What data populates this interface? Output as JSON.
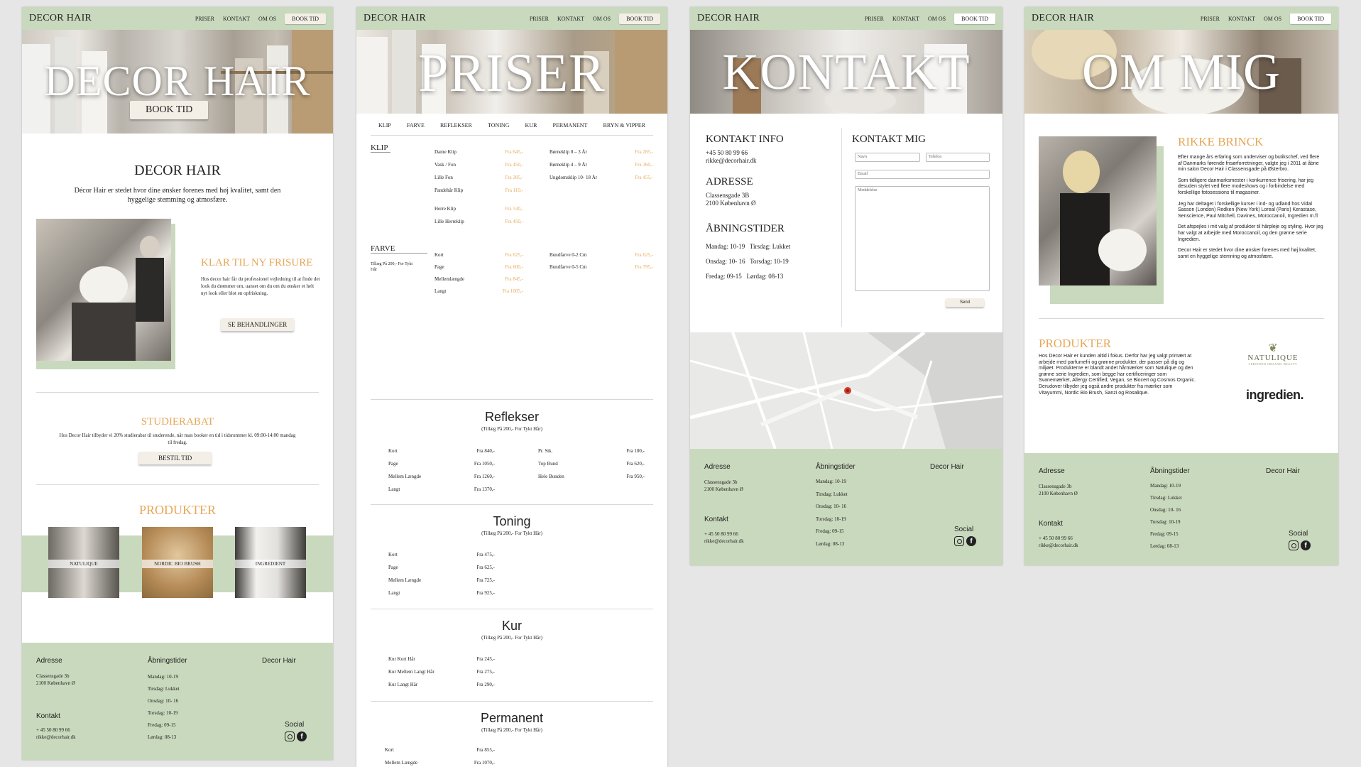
{
  "nav": {
    "logo": "DECOR HAIR",
    "links": [
      "PRISER",
      "KONTAKT",
      "OM OS"
    ],
    "book": "BOOK TID"
  },
  "p1": {
    "hero_title": "DECOR HAIR",
    "hero_button": "BOOK TID",
    "intro_title": "DECOR HAIR",
    "intro_text": "Décor Hair er stedet hvor dine ønsker forenes med høj kvalitet, samt den hyggelige stemming og atmosfære.",
    "klar_title": "KLAR TIL NY FRISURE",
    "klar_text": "Hos decor hair får du professionel vejledning til at finde det look du drømmer om, uanset om du om du ønsker et helt nyt look eller blot en opfriskning.",
    "klar_button": "SE BEHANDLINGER",
    "studie_title": "STUDIERABAT",
    "studie_text": "Hos Decor Hair tilbyder vi 20% studierabat til studerende, når man booker en tid i tidsrummet kl. 09:00-14:00 mandag til fredag.",
    "studie_button": "BESTIL TID",
    "produkter_title": "PRODUKTER",
    "products": [
      "NATULIQUE",
      "NORDIC BIO BRUSH",
      "INGREDIENT"
    ]
  },
  "footer": {
    "adresse_label": "Adresse",
    "adresse": [
      "Classensgade 3b",
      "2100 København Ø"
    ],
    "kontakt_label": "Kontakt",
    "kontakt": [
      "+ 45 50 80 99 66",
      "rikke@decorhair.dk"
    ],
    "aabning_label": "Åbningstider",
    "aabning": [
      "Mandag: 10-19",
      "Tirsdag: Lukket",
      "Onsdag: 10- 16",
      "Torsdag: 10-19",
      "Fredag: 09-15",
      "Lørdag: 08-13"
    ],
    "brand": "Decor Hair",
    "social": "Social"
  },
  "p2": {
    "hero_title": "PRISER",
    "tabs": [
      "KLIP",
      "FARVE",
      "REFLEKSER",
      "TONING",
      "KUR",
      "PERMANENT",
      "BRYN & VIPPER"
    ],
    "klip_label": "KLIP",
    "klip_left": [
      [
        "Dame Klip",
        "Fra 645,-"
      ],
      [
        "Vask / Fon",
        "Fra 450,-"
      ],
      [
        "Lille Fon",
        "Fra 285,-"
      ],
      [
        "Pandehår Klip",
        "Fra 110,-"
      ],
      [
        "",
        ""
      ],
      [
        "Herre Klip",
        "Fra 530,-"
      ],
      [
        "Lille Herreklip",
        "Fra 450,-"
      ]
    ],
    "klip_right": [
      [
        "Børneklip 0 – 3 År",
        "Fra 285,-"
      ],
      [
        "Børneklip 4 – 9 År",
        "Fra 360,-"
      ],
      [
        "Ungdomsklip 10- 18 År",
        "Fra 455,-"
      ]
    ],
    "farve_label": "FARVE",
    "farve_note": "Tillæg På 200,- For Tykt Hår",
    "farve_left": [
      [
        "Kort",
        "Fra 625,-"
      ],
      [
        "Page",
        "Fra 600,-"
      ],
      [
        "Mellemlængde",
        "Fra 845,-"
      ],
      [
        "Langt",
        "Fra 1005,-"
      ]
    ],
    "farve_right": [
      [
        "Bundfarve 0-2 Cm",
        "Fra 625,-"
      ],
      [
        "Bundfarve 0-5 Cm",
        "Fra 795,-"
      ]
    ],
    "ref_title": "Reflekser",
    "ref_note": "(Tillæg På 200,- For Tykt Hår)",
    "ref_left": [
      [
        "Kort",
        "Fra 840,-"
      ],
      [
        "Page",
        "Fra 1050,-"
      ],
      [
        "Mellem Længde",
        "Fra 1260,-"
      ],
      [
        "Langt",
        "Fra 1370,-"
      ]
    ],
    "ref_right": [
      [
        "Pr. Stk.",
        "Fra 100,-"
      ],
      [
        "Top Bund",
        "Fra 620,-"
      ],
      [
        "Hele Bunden",
        "Fra 950,-"
      ]
    ],
    "ton_title": "Toning",
    "ton_note": "(Tillæg På 200,- For Tykt Hår)",
    "ton_rows": [
      [
        "Kort",
        "Fra 475,-"
      ],
      [
        "Page",
        "Fra 625,-"
      ],
      [
        "Mellem Længde",
        "Fra 725,-"
      ],
      [
        "Langt",
        "Fra 925,-"
      ]
    ],
    "kur_title": "Kur",
    "kur_note": "(Tillæg På 200,- For Tykt Hår)",
    "kur_rows": [
      [
        "Kur Kort Hår",
        "Fra 245,-"
      ],
      [
        "Kur Mellem Langt Hår",
        "Fra 275,-"
      ],
      [
        "Kur Langt Hår",
        "Fra 290,-"
      ]
    ],
    "perm_title": "Permanent",
    "perm_note": "(Tillæg På 200,- For Tykt Hår)",
    "perm_rows": [
      [
        "Kort",
        "Fra 855,-"
      ],
      [
        "Mellem Længde",
        "Fra 1070,-"
      ]
    ]
  },
  "p3": {
    "hero_title": "KONTAKT",
    "info_title": "KONTAKT INFO",
    "info_phone": "+45 50 80 99 66",
    "info_email": "rikke@decorhair.dk",
    "adresse_title": "ADRESSE",
    "adresse_lines": [
      "Classensgade 3B",
      "2100 København Ø"
    ],
    "aabning_title": "ÅBNINGSTIDER",
    "aabning_lines": [
      "Mandag: 10-19   Tirsdag: Lukket",
      "Onsdag: 10- 16   Torsdag: 10-19",
      "Fredag: 09-15   Lørdag: 08-13"
    ],
    "form_title": "KONTAKT MIG",
    "ph_name": "Navn",
    "ph_phone": "Telefon",
    "ph_email": "Email",
    "ph_message": "Meddelelse",
    "send": "Send"
  },
  "p4": {
    "hero_title": "OM MIG",
    "name": "RIKKE BRINCK",
    "bio": [
      "Efter mange års erfaring som underviser og butikschef, ved flere af Danmarks førende frisørforretninger, valgte jeg i 2011 at åbne min salon Decor Hair i Classensgade på Østerbro.",
      "Som tidligere danmarksmester i konkurrence frisering, har jeg desuden stylet ved flere modeshows og i forbindelse med forskellige fotosessions til magasiner.",
      "Jeg har deltaget i forskellige kurser i ind- og udland hos Vidal Sasson (London) Redken (New York) Loreal (Paris) Kerastase, Senscience, Paul Mitchell, Davines, Moroccanoil, Ingredien  m.fl",
      "Det afspejles i mit valg af produkter til hårpleje og styling. Hvor jeg har valgt at arbejde med Moroccanoil, og den grønne serie Ingredien.",
      "Decor Hair er stedet hvor dine ønsker forenes med høj kvalitet, samt en hyggelige stemning og atmosfære."
    ],
    "prod_title": "PRODUKTER",
    "prod_text": "Hos Decor Hair er kunden altid i fokus. Derfor har jeg valgt primært at arbejde med parfumefri og grønne produkter, der passer på dig og miljøet. Produkterne er blandt andet hårmærker som Natulique og den grønne serie Ingredien, som begge har certificeringer som Svanemærket, Allergy Certified, Vegan, se Biocert og Cosmos Organic. Derudover tilbyder jeg også andre produkter fra mærker som Vitayummi, Nordic Bio Brush, Sanzi og Rosalique.",
    "logo1": "NATULIQUE",
    "logo1_sub": "CERTIFIED ORGANIC BEAUTY",
    "logo2": "ingredien."
  }
}
